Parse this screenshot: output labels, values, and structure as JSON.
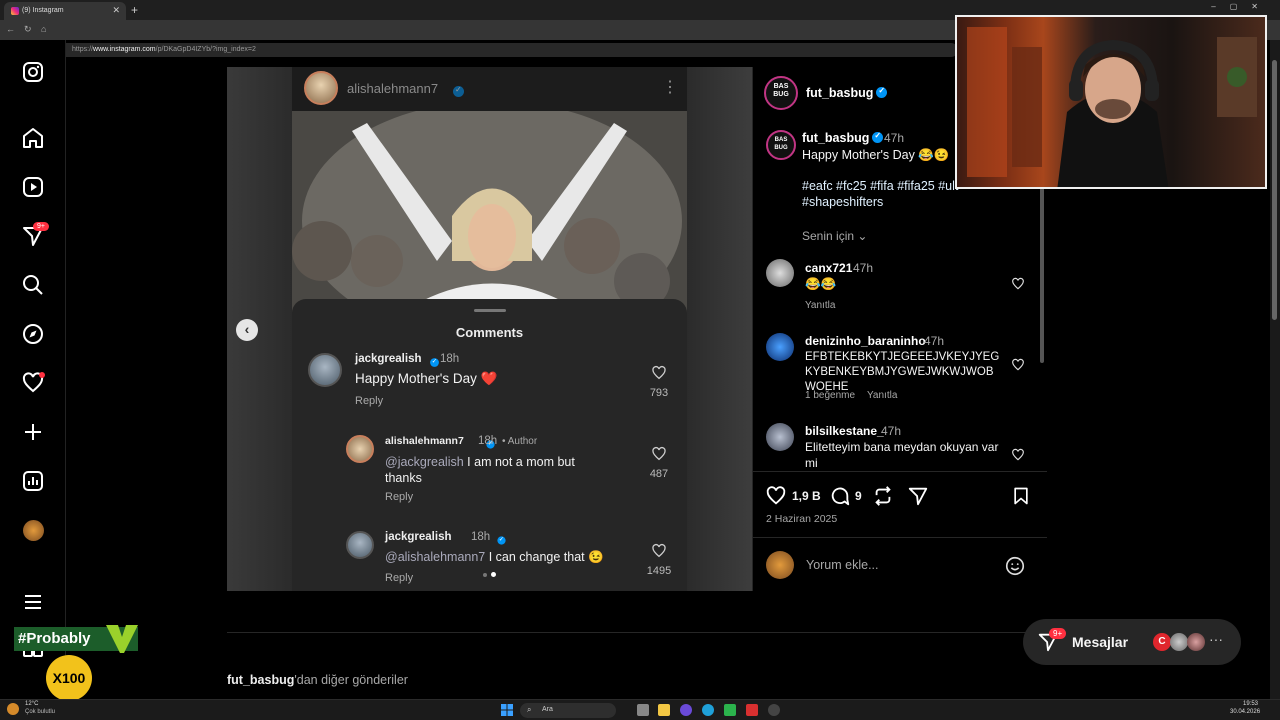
{
  "browser": {
    "tab_title": "(9) Instagram",
    "url_prefix": "https://",
    "url_domain": "www.instagram.com",
    "url_path": "/p/DKaGpD4IZYb/?img_index=2"
  },
  "leftnav": {
    "notification_badge": "9+"
  },
  "post": {
    "inner": {
      "username": "alishalehmann7",
      "sheet_title": "Comments",
      "comments": [
        {
          "user": "jackgrealish",
          "time": "18h",
          "text": "Happy Mother's Day ❤️",
          "reply": "Reply",
          "likes": "793"
        },
        {
          "user": "alishalehmann7",
          "time": "18h",
          "author_tag": "• Author",
          "mention": "@jackgrealish",
          "text": " I am not a mom but thanks",
          "reply": "Reply",
          "likes": "487"
        },
        {
          "user": "jackgrealish",
          "time": "18h",
          "mention": "@alishalehmann7",
          "text": " I can change that 😉",
          "reply": "Reply",
          "likes": "1495"
        }
      ]
    }
  },
  "side": {
    "header_user": "fut_basbug",
    "caption_user": "fut_basbug",
    "caption_time": "47h",
    "caption_text": "Happy Mother's Day 😂😉",
    "hashtags_line1": "#eafc #fc25 #fifa #fifa25 #ult",
    "hashtags_line2": "#shapeshifters",
    "for_you": "Senin için",
    "comments": [
      {
        "user": "canx721",
        "time": "47h",
        "text": "😂😂",
        "reply": "Yanıtla"
      },
      {
        "user": "denizinho_baraninho",
        "time": "47h",
        "text": "EFBTEKEBKYTJEGEEEJVKEYJYEGKYBENKEYBMJYGWEJWKWJWOBWOEHE",
        "likes": "1 beğenme",
        "reply": "Yanıtla"
      },
      {
        "user": "bilsilkestane_",
        "time": "47h",
        "text": "Elitetteyim bana meydan okuyan var mi"
      }
    ],
    "likes_count": "1,9 B",
    "comments_count": "9",
    "date": "2 Haziran 2025",
    "comment_placeholder": "Yorum ekle..."
  },
  "more_posts": {
    "user": "fut_basbug",
    "suffix": "'dan diğer gönderiler"
  },
  "messages": {
    "label": "Mesajlar",
    "badge": "9+",
    "avatar_letter": "C"
  },
  "overlays": {
    "probably_text": "#Probably",
    "x100_text": "X100"
  },
  "taskbar": {
    "weather_temp": "12°C",
    "weather_desc": "Çok bulutlu",
    "search_label": "Ara",
    "clock_time": "19:53",
    "clock_date": "30.04.2026"
  }
}
